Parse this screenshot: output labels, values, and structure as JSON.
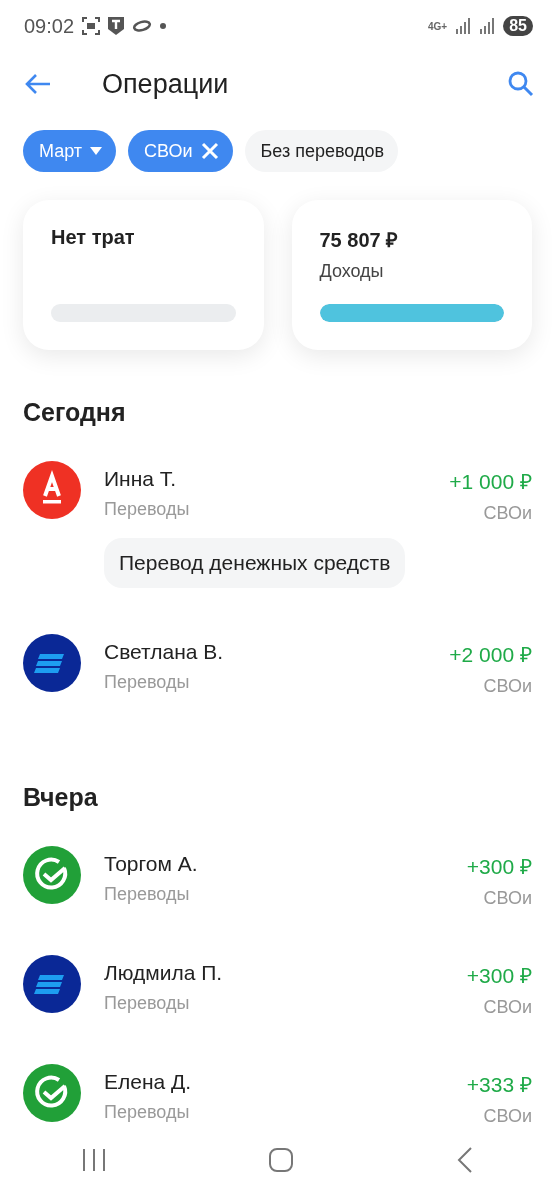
{
  "status_bar": {
    "time": "09:02",
    "network": "4G+",
    "battery": "85"
  },
  "header": {
    "title": "Операции"
  },
  "chips": [
    {
      "label": "Март",
      "kind": "dropdown",
      "selected": true
    },
    {
      "label": "СВОи",
      "kind": "removable",
      "selected": true
    },
    {
      "label": "Без переводов",
      "kind": "plain",
      "selected": false
    }
  ],
  "summary": [
    {
      "kind": "expense",
      "title": "Нет трат"
    },
    {
      "kind": "income",
      "amount": "75 807 ₽",
      "label": "Доходы",
      "level": 1
    }
  ],
  "sections": [
    {
      "title": "Сегодня",
      "operations": [
        {
          "name": "Инна Т.",
          "category": "Переводы",
          "amount": "+1 000 ₽",
          "account": "СВОи",
          "kind": "alfa",
          "comment": "Перевод денежных средств"
        },
        {
          "name": "Светлана В.",
          "category": "Переводы",
          "amount": "+2 000 ₽",
          "account": "СВОи",
          "kind": "vtb"
        }
      ]
    },
    {
      "title": "Вчера",
      "operations": [
        {
          "name": "Торгом А.",
          "category": "Переводы",
          "amount": "+300 ₽",
          "account": "СВОи",
          "kind": "sber"
        },
        {
          "name": "Людмила П.",
          "category": "Переводы",
          "amount": "+300 ₽",
          "account": "СВОи",
          "kind": "vtb"
        },
        {
          "name": "Елена Д.",
          "category": "Переводы",
          "amount": "+333 ₽",
          "account": "СВОи",
          "kind": "sber"
        }
      ]
    }
  ]
}
